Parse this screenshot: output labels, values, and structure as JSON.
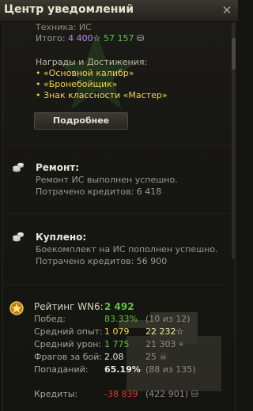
{
  "window": {
    "title": "Центр уведомлений",
    "close_glyph": "✕"
  },
  "battle_block": {
    "tech_line": "Техника: ИС",
    "total_label": "Итого:",
    "total_xp": "4 400",
    "total_credits": "57 157",
    "awards_title": "Награды и Достижения:",
    "awards": [
      "«Основной калибр»",
      "«Бронебойщик»",
      "Знак классности «Мастер»"
    ],
    "details_button": "Подробнее"
  },
  "repair_block": {
    "title": "Ремонт:",
    "line1": "Ремонт ИС выполнен успешно.",
    "spent_label": "Потрачено кредитов:",
    "spent_value": "6 418"
  },
  "purchase_block": {
    "title": "Куплено:",
    "line1": "Боекомплект на ИС пополнен успешно.",
    "spent_label": "Потрачено кредитов:",
    "spent_value": "56 900"
  },
  "stats_block": {
    "wn6_label": "Рейтинг WN6:",
    "wn6_value": "2 492",
    "wins_label": "Побед:",
    "wins_pct": "83.33%",
    "wins_extra": "(10 из 12)",
    "avg_xp_label": "Средний опыт:",
    "avg_xp": "1 079",
    "avg_xp_total": "22 232",
    "avg_dmg_label": "Средний урон:",
    "avg_dmg": "1 775",
    "avg_dmg_total": "21 303",
    "frags_label": "Фрагов за бой:",
    "frags": "2.08",
    "frags_total": "25",
    "hits_label": "Попаданий:",
    "hits_pct": "65.19%",
    "hits_extra": "(88 из 135)",
    "credits_label": "Кредиты:",
    "credits_value": "-38 839",
    "credits_total": "(422 901)"
  },
  "colors": {
    "gold": "#f0d350",
    "green": "#5fc63c",
    "purple": "#b590f0",
    "red": "#f1322f"
  },
  "icons": [
    "close-icon",
    "xp-star-icon",
    "credits-coin-icon",
    "stack-coins-icon",
    "medal-icon",
    "target-icon",
    "skull-icon"
  ]
}
